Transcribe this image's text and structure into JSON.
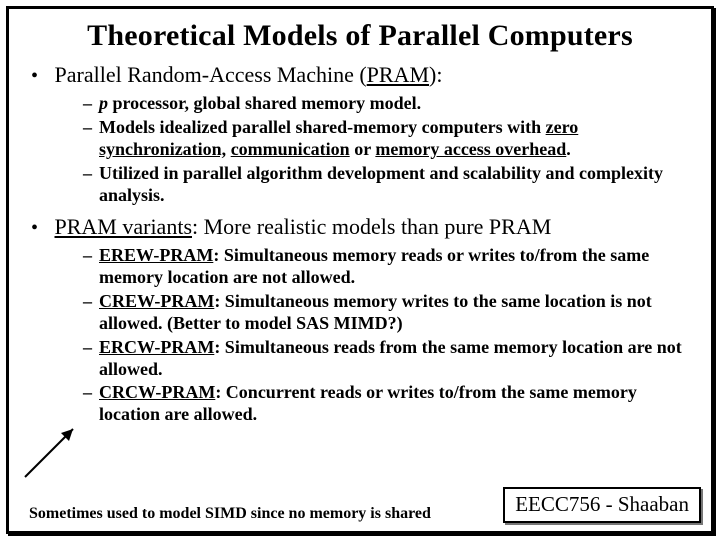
{
  "title": "Theoretical Models of Parallel Computers",
  "bullet1": {
    "lead": "Parallel Random-Access Machine (",
    "acronym": "PRAM",
    "tail": "):",
    "sub": [
      {
        "pre": "",
        "em": "p",
        "post": "  processor, global shared memory model."
      },
      {
        "pre": "Models idealized parallel  shared-memory computers with ",
        "u1": "zero synchronization,",
        "mid1": " ",
        "u2": "communication",
        "mid2": " or ",
        "u3": "memory access overhead",
        "post": "."
      },
      {
        "text": "Utilized in parallel algorithm development and scalability and complexity analysis."
      }
    ]
  },
  "bullet2": {
    "lead_u": "PRAM variants",
    "tail": ": More realistic models than pure PRAM",
    "sub": [
      {
        "label": "EREW-PRAM",
        "desc": ":  Simultaneous memory reads or writes to/from the same memory location are not allowed."
      },
      {
        "label": "CREW-PRAM",
        "desc": ":  Simultaneous memory writes to the same location is not allowed.  (Better to model SAS MIMD?)"
      },
      {
        "label": "ERCW-PRAM",
        "desc": ": Simultaneous reads from the same memory location are not allowed."
      },
      {
        "label": "CRCW-PRAM",
        "desc": ": Concurrent reads or writes  to/from the same memory location are allowed."
      }
    ]
  },
  "footer_note": "Sometimes used to model SIMD since no memory is shared",
  "footer_box": "EECC756 - Shaaban"
}
